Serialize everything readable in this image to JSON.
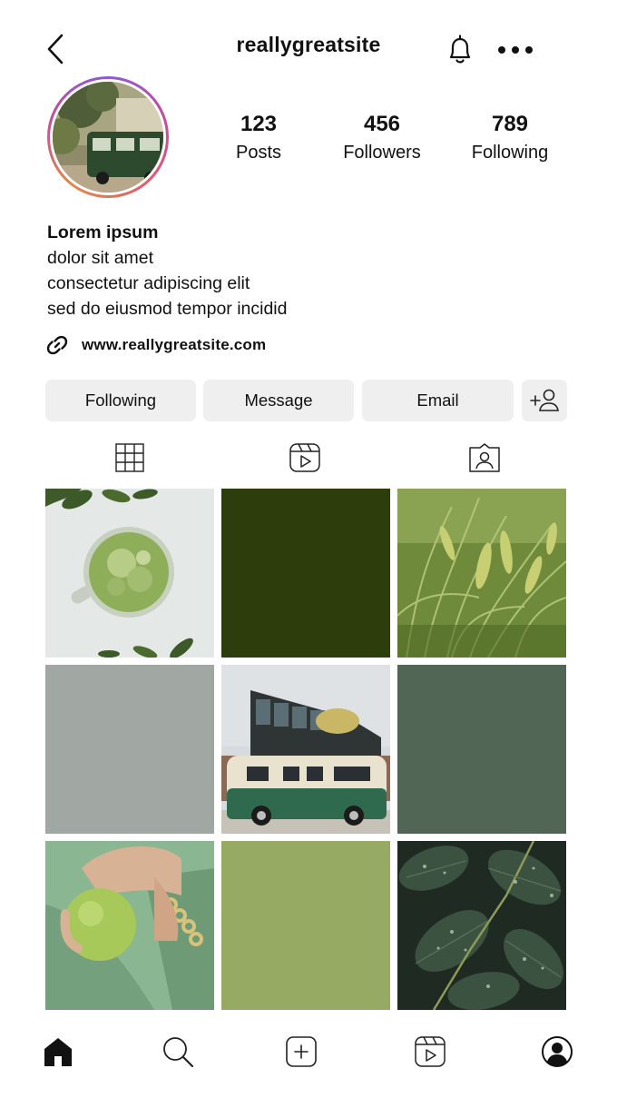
{
  "header": {
    "username": "reallygreatsite"
  },
  "stats": [
    {
      "value": "123",
      "label": "Posts"
    },
    {
      "value": "456",
      "label": "Followers"
    },
    {
      "value": "789",
      "label": "Following"
    }
  ],
  "bio": {
    "name": "Lorem ipsum",
    "lines": [
      "dolor sit amet",
      "consectetur adipiscing elit",
      "sed do eiusmod tempor incidid"
    ]
  },
  "link": {
    "url": "www.reallygreatsite.com"
  },
  "actions": {
    "following_label": "Following",
    "message_label": "Message",
    "email_label": "Email"
  },
  "tabs": [
    "grid-icon",
    "reels-icon",
    "tagged-icon"
  ],
  "grid": [
    {
      "type": "photo",
      "subject": "matcha drink"
    },
    {
      "type": "color",
      "color": "#2d3e0c"
    },
    {
      "type": "photo",
      "subject": "wheat field"
    },
    {
      "type": "color",
      "color": "#a1a7a3"
    },
    {
      "type": "photo",
      "subject": "vintage green van"
    },
    {
      "type": "color",
      "color": "#526656"
    },
    {
      "type": "photo",
      "subject": "green apple"
    },
    {
      "type": "color",
      "color": "#96aa63"
    },
    {
      "type": "photo",
      "subject": "wet leaves"
    }
  ],
  "bottom_nav": [
    "home-icon",
    "search-icon",
    "add-post-icon",
    "reels-icon",
    "profile-icon"
  ]
}
